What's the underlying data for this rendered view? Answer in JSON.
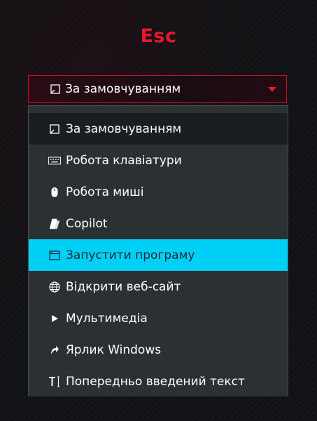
{
  "header": {
    "title": "Esc",
    "title_color": "#e4192c"
  },
  "select": {
    "icon": "default-shortcut-icon",
    "value": "За замовчуванням",
    "border_color": "#c8102e",
    "caret_color": "#e4192c"
  },
  "dropdown": {
    "highlight_color": "#00d0f5",
    "items": [
      {
        "label": "За замовчуванням",
        "icon": "default-shortcut-icon",
        "state": "current"
      },
      {
        "label": "Робота клавіатури",
        "icon": "keyboard-icon",
        "state": "normal"
      },
      {
        "label": "Робота миші",
        "icon": "mouse-icon",
        "state": "normal"
      },
      {
        "label": "Copilot",
        "icon": "copilot-icon",
        "state": "normal"
      },
      {
        "label": "Запустити програму",
        "icon": "app-window-icon",
        "state": "highlighted"
      },
      {
        "label": "Відкрити веб-сайт",
        "icon": "globe-icon",
        "state": "normal"
      },
      {
        "label": "Мультимедіа",
        "icon": "play-icon",
        "state": "normal"
      },
      {
        "label": "Ярлик Windows",
        "icon": "shortcut-arrow-icon",
        "state": "normal"
      },
      {
        "label": "Попередньо введений текст",
        "icon": "text-cursor-icon",
        "state": "normal"
      }
    ]
  }
}
